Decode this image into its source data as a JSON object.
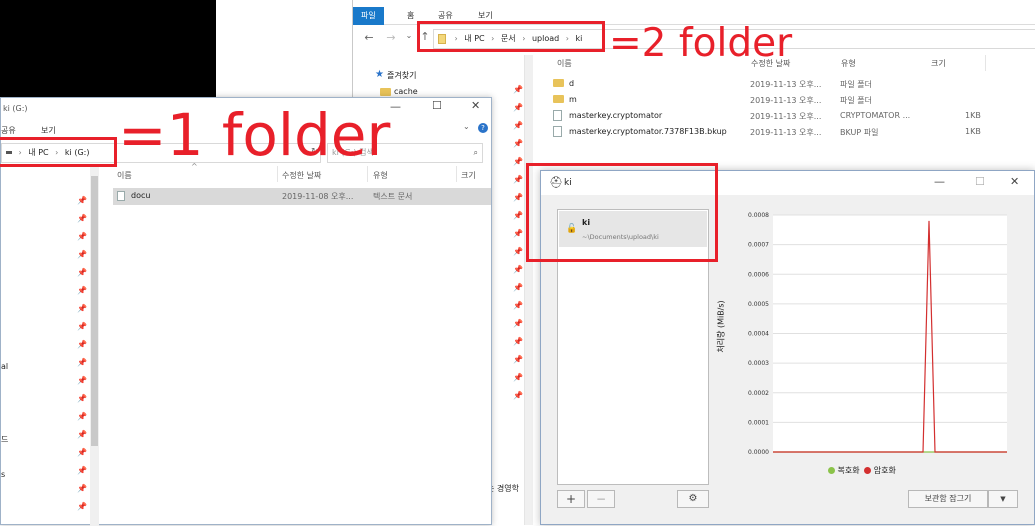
{
  "window2": {
    "ribbon_tabs": [
      "파일",
      "홈",
      "공유",
      "보기"
    ],
    "breadcrumb": [
      "내 PC",
      "문서",
      "upload",
      "ki"
    ],
    "sidebar": {
      "quick_access": "즐겨찾기",
      "cache": "cache"
    },
    "columns": {
      "name": "이름",
      "date": "수정한 날짜",
      "type": "유형",
      "size": "크기"
    },
    "files": [
      {
        "name": "d",
        "date": "2019-11-13 오후...",
        "type": "파일 폴더",
        "size": ""
      },
      {
        "name": "m",
        "date": "2019-11-13 오후...",
        "type": "파일 폴더",
        "size": ""
      },
      {
        "name": "masterkey.cryptomator",
        "date": "2019-11-13 오후...",
        "type": "CRYPTOMATOR ...",
        "size": "1KB"
      },
      {
        "name": "masterkey.cryptomator.7378F13B.bkup",
        "date": "2019-11-13 오후...",
        "type": "BKUP 파일",
        "size": "1KB"
      }
    ],
    "sidebar_fragment": "는 경영학"
  },
  "window1": {
    "title": "ki (G:)",
    "ribbon_tabs": [
      "공유",
      "보기"
    ],
    "breadcrumb": [
      "내 PC",
      "ki (G:)"
    ],
    "search_placeholder": "ki (G:) 검색",
    "columns": {
      "name": "이름",
      "date": "수정한 날짜",
      "type": "유형",
      "size": "크기"
    },
    "files": [
      {
        "name": "docu",
        "date": "2019-11-08 오후...",
        "type": "텍스트 문서",
        "size": ""
      }
    ],
    "sidebar_fragments": [
      "al",
      "드",
      "s"
    ]
  },
  "cryptomator": {
    "title": "ki",
    "vault": {
      "name": "ki",
      "path": "~\\Documents\\upload\\ki"
    },
    "add_symbol": "+",
    "remove_symbol": "−",
    "lock_button": "보관함 잠그기",
    "dropdown_symbol": "▼"
  },
  "chart_data": {
    "type": "line",
    "ylabel": "처리량 (MiB/s)",
    "yticks": [
      "0.0008",
      "0.0007",
      "0.0006",
      "0.0005",
      "0.0004",
      "0.0003",
      "0.0002",
      "0.0001",
      "0.0000"
    ],
    "ylim": [
      0,
      0.0008
    ],
    "series": [
      {
        "name": "복호화",
        "color": "#8bc34a",
        "values": [
          0,
          0,
          0,
          0,
          0,
          0,
          0,
          0,
          0,
          0,
          0,
          0,
          0,
          0,
          0,
          0,
          0,
          0,
          0,
          0,
          0,
          0,
          0,
          0,
          0,
          0,
          0,
          0,
          0,
          0,
          0,
          0,
          0,
          0,
          0,
          0,
          0,
          0,
          0,
          0
        ]
      },
      {
        "name": "암호화",
        "color": "#d32f2f",
        "values": [
          0,
          0,
          0,
          0,
          0,
          0,
          0,
          0,
          0,
          0,
          0,
          0,
          0,
          0,
          0,
          0,
          0,
          0,
          0,
          0,
          0,
          0,
          0,
          0,
          0,
          0,
          0.00078,
          0,
          0,
          0,
          0,
          0,
          0,
          0,
          0,
          0,
          0,
          0,
          0,
          0
        ]
      }
    ],
    "grid": true,
    "legend_position": "bottom"
  },
  "annotations": {
    "label1": "=1 folder",
    "label2": "=2 folder",
    "color": "#e8202a"
  }
}
